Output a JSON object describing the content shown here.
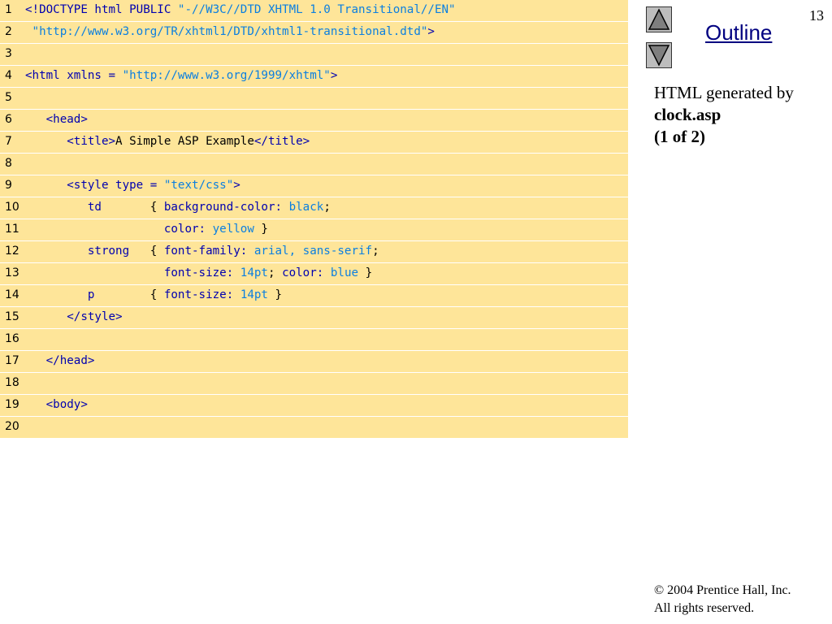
{
  "slide_number": "13",
  "outline_label": "Outline",
  "description": {
    "line1": "HTML generated by",
    "line2": "clock.asp",
    "line3": "(1 of 2)"
  },
  "footer": {
    "copyright_symbol": "©",
    "line1": " 2004 Prentice Hall, Inc.",
    "line2": "All rights reserved."
  },
  "nav": {
    "up_icon": "triangle-up-icon",
    "down_icon": "triangle-down-icon"
  },
  "colors": {
    "code_background": "#fee599",
    "keyword": "#0000b0",
    "string": "#0b7fe0",
    "link": "#000080",
    "button": "#bdbdbd"
  },
  "code": [
    {
      "no": "1",
      "tokens": [
        {
          "t": "<!DOCTYPE html PUBLIC ",
          "c": "blue"
        },
        {
          "t": "\"-//W3C//DTD XHTML 1.0 Transitional//EN\"",
          "c": "cyan"
        }
      ]
    },
    {
      "no": "2",
      "tokens": [
        {
          "t": " \"http://www.w3.org/TR/xhtml1/DTD/xhtml1-transitional.dtd\"",
          "c": "cyan"
        },
        {
          "t": ">",
          "c": "blue"
        }
      ]
    },
    {
      "no": "3",
      "tokens": []
    },
    {
      "no": "4",
      "tokens": [
        {
          "t": "<html xmlns = ",
          "c": "blue"
        },
        {
          "t": "\"http://www.w3.org/1999/xhtml\"",
          "c": "cyan"
        },
        {
          "t": ">",
          "c": "blue"
        }
      ]
    },
    {
      "no": "5",
      "tokens": []
    },
    {
      "no": "6",
      "tokens": [
        {
          "t": "   <head>",
          "c": "blue"
        }
      ]
    },
    {
      "no": "7",
      "tokens": [
        {
          "t": "      <title>",
          "c": "blue"
        },
        {
          "t": "A Simple ASP Example",
          "c": "black"
        },
        {
          "t": "</title>",
          "c": "blue"
        }
      ]
    },
    {
      "no": "8",
      "tokens": []
    },
    {
      "no": "9",
      "tokens": [
        {
          "t": "      <style type = ",
          "c": "blue"
        },
        {
          "t": "\"text/css\"",
          "c": "cyan"
        },
        {
          "t": ">",
          "c": "blue"
        }
      ]
    },
    {
      "no": "10",
      "tokens": [
        {
          "t": "         td       ",
          "c": "blue"
        },
        {
          "t": "{ ",
          "c": "black"
        },
        {
          "t": "background-color: ",
          "c": "blue"
        },
        {
          "t": "black",
          "c": "cyan"
        },
        {
          "t": ";",
          "c": "black"
        }
      ]
    },
    {
      "no": "11",
      "tokens": [
        {
          "t": "                    color: ",
          "c": "blue"
        },
        {
          "t": "yellow",
          "c": "cyan"
        },
        {
          "t": " }",
          "c": "black"
        }
      ]
    },
    {
      "no": "12",
      "tokens": [
        {
          "t": "         strong   ",
          "c": "blue"
        },
        {
          "t": "{ ",
          "c": "black"
        },
        {
          "t": "font-family: ",
          "c": "blue"
        },
        {
          "t": "arial, sans-serif",
          "c": "cyan"
        },
        {
          "t": ";",
          "c": "black"
        }
      ]
    },
    {
      "no": "13",
      "tokens": [
        {
          "t": "                    font-size: ",
          "c": "blue"
        },
        {
          "t": "14pt",
          "c": "cyan"
        },
        {
          "t": "; ",
          "c": "black"
        },
        {
          "t": "color: ",
          "c": "blue"
        },
        {
          "t": "blue",
          "c": "cyan"
        },
        {
          "t": " }",
          "c": "black"
        }
      ]
    },
    {
      "no": "14",
      "tokens": [
        {
          "t": "         p        ",
          "c": "blue"
        },
        {
          "t": "{ ",
          "c": "black"
        },
        {
          "t": "font-size: ",
          "c": "blue"
        },
        {
          "t": "14pt",
          "c": "cyan"
        },
        {
          "t": " }",
          "c": "black"
        }
      ]
    },
    {
      "no": "15",
      "tokens": [
        {
          "t": "      </style>",
          "c": "blue"
        }
      ]
    },
    {
      "no": "16",
      "tokens": []
    },
    {
      "no": "17",
      "tokens": [
        {
          "t": "   </head>",
          "c": "blue"
        }
      ]
    },
    {
      "no": "18",
      "tokens": []
    },
    {
      "no": "19",
      "tokens": [
        {
          "t": "   <body>",
          "c": "blue"
        }
      ]
    },
    {
      "no": "20",
      "tokens": []
    }
  ]
}
